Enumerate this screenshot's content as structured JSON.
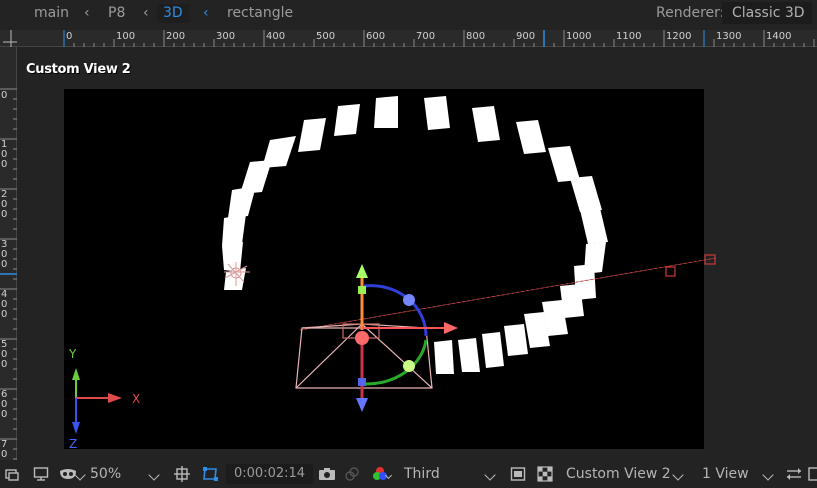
{
  "breadcrumbs": [
    {
      "label": "main",
      "active": false
    },
    {
      "label": "P8",
      "active": false
    },
    {
      "label": "3D",
      "active": true
    },
    {
      "label": "rectangle",
      "active": false
    }
  ],
  "renderer": {
    "label": "Renderer:",
    "value": "Classic 3D"
  },
  "hruler": {
    "ticks": [
      "0",
      "100",
      "200",
      "300",
      "400",
      "500",
      "600",
      "700",
      "800",
      "900",
      "1000",
      "1100",
      "1200",
      "1300",
      "1400"
    ]
  },
  "vruler": {
    "ticks": [
      [
        "0"
      ],
      [
        "1",
        "0",
        "0"
      ],
      [
        "2",
        "0",
        "0"
      ],
      [
        "3",
        "0",
        "0"
      ],
      [
        "4",
        "0",
        "0"
      ],
      [
        "5",
        "0",
        "0"
      ],
      [
        "6",
        "0",
        "0"
      ],
      [
        "7",
        "0"
      ]
    ]
  },
  "view": {
    "title": "Custom View 2"
  },
  "axes": {
    "x": "X",
    "y": "Y",
    "z": "Z"
  },
  "bottombar": {
    "magnification": "50%",
    "timecode": "0:00:02:14",
    "resolution": "Third",
    "view_name": "Custom View 2",
    "view_layout": "1 View"
  },
  "colors": {
    "accent": "#2e8de6",
    "background": "#232323",
    "comp_bg": "#000000",
    "x_axis": "#e04a4a",
    "y_axis": "#8ee04a",
    "z_axis": "#5577ff"
  }
}
